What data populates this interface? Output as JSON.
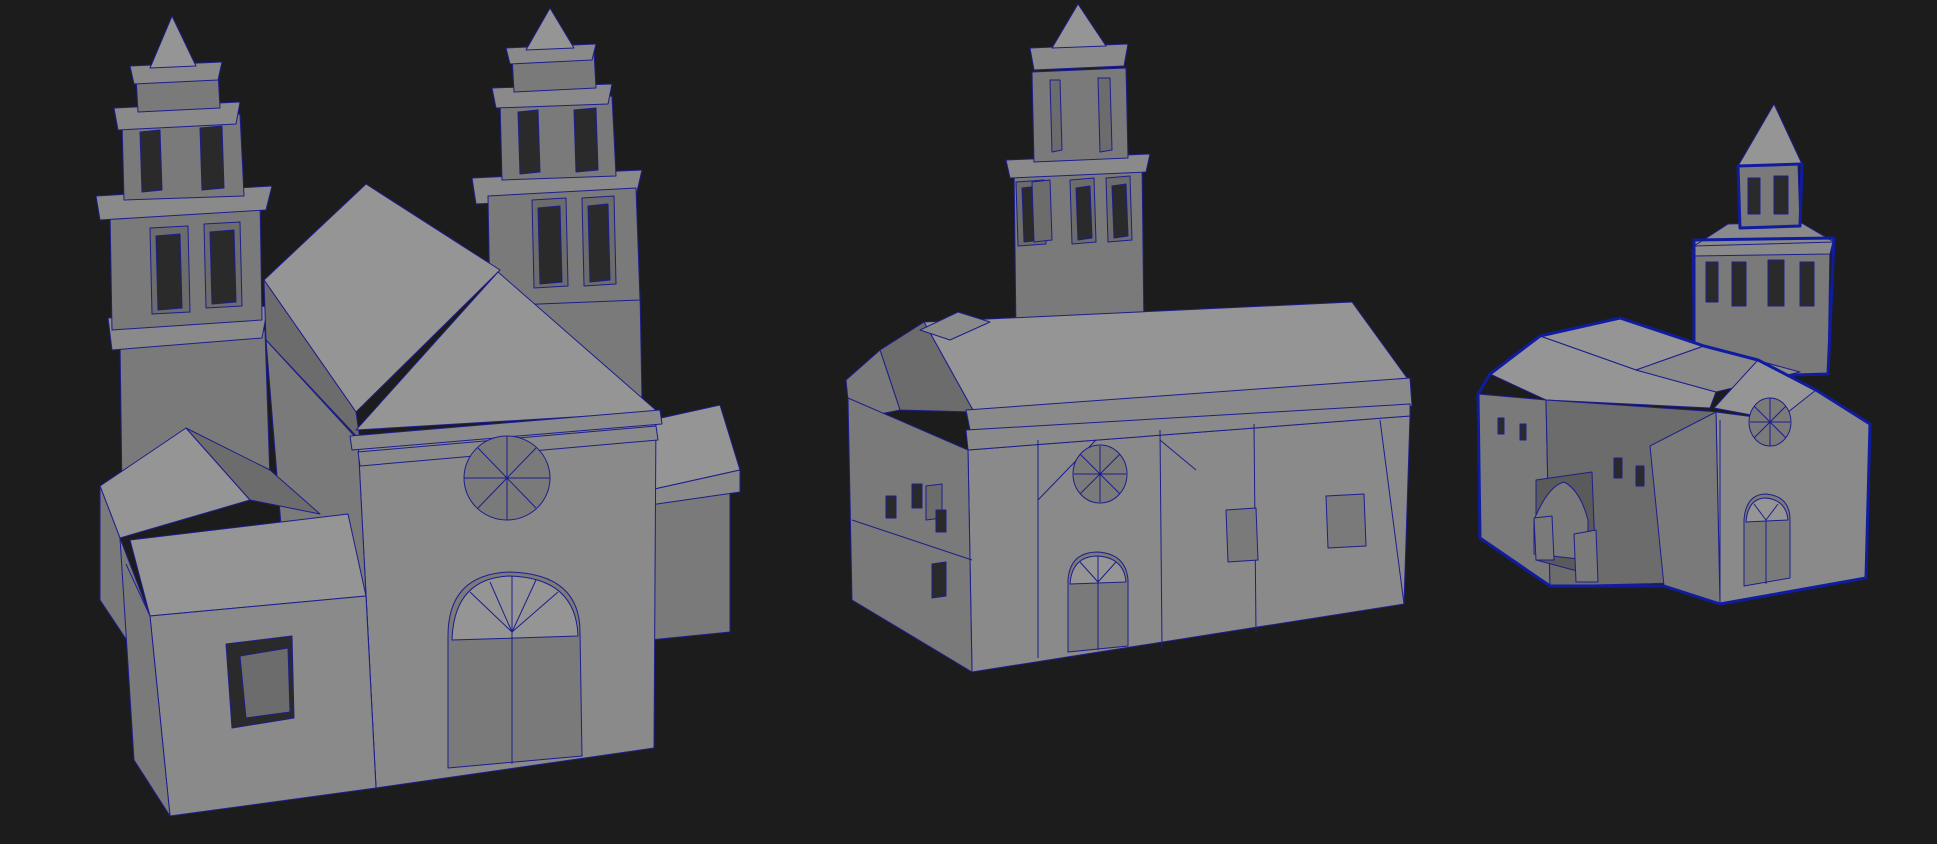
{
  "viewport": {
    "background": "#1c1c1c",
    "model_fill": "#8a8a8a",
    "wireframe_color": "#1c1e8c",
    "selection_color": "#101ca0"
  },
  "models": [
    {
      "name": "church-large-twin-towers",
      "towers": 2,
      "selected": false
    },
    {
      "name": "church-medium-single-tower",
      "towers": 1,
      "selected": false
    },
    {
      "name": "church-small-single-tower",
      "towers": 1,
      "selected": true
    }
  ]
}
